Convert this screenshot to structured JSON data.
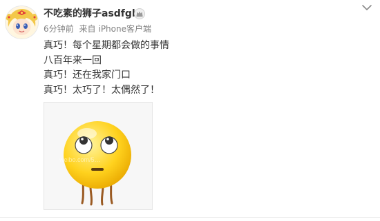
{
  "post": {
    "author": "不吃素的狮子asdfgh",
    "time": "6分钟前",
    "source_prefix": "来自",
    "source": "iPhone客户端",
    "lines": [
      "真巧！每个星期都会做的事情",
      "八百年来一回",
      "真巧！还在我家门口",
      "真巧！太巧了！太偶然了！"
    ],
    "image_watermark": "weibo.com/5…",
    "icons": {
      "badge": "vip-crown-icon",
      "menu": "chevron-down-icon"
    }
  }
}
